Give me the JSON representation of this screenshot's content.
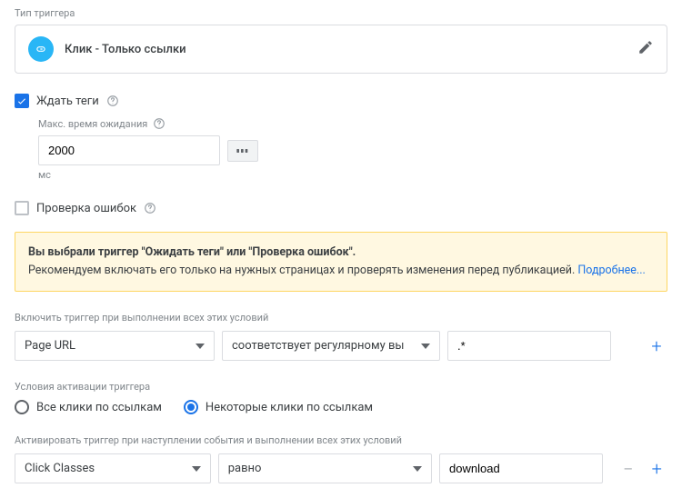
{
  "header": {
    "section_label": "Тип триггера",
    "trigger_name": "Клик - Только ссылки"
  },
  "wait_tags": {
    "label": "Ждать теги",
    "max_wait_label": "Макс. время ожидания",
    "value": "2000",
    "unit": "мс"
  },
  "error_check": {
    "label": "Проверка ошибок"
  },
  "warning": {
    "line1": "Вы выбрали триггер \"Ожидать теги\" или \"Проверка ошибок\".",
    "line2_prefix": "Рекомендуем включать его только на нужных страницах и проверять изменения перед публикацией. ",
    "link": "Подробнее..."
  },
  "enable_cond": {
    "label": "Включить триггер при выполнении всех этих условий",
    "var": "Page URL",
    "op": "соответствует регулярному вы",
    "val": ".*"
  },
  "activation": {
    "label": "Условия активации триггера",
    "opt_all": "Все клики по ссылкам",
    "opt_some": "Некоторые клики по ссылкам"
  },
  "fire_cond": {
    "label": "Активировать триггер при наступлении события и выполнении всех этих условий",
    "var": "Click Classes",
    "op": "равно",
    "val": "download"
  }
}
